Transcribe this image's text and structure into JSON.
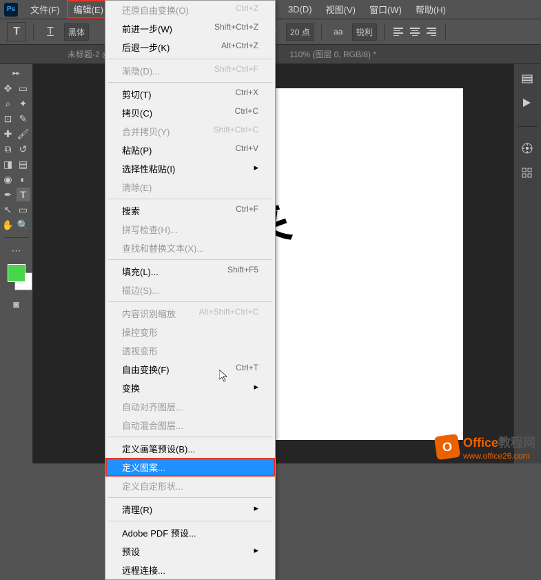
{
  "menubar": {
    "items": [
      "文件(F)",
      "编辑(E)",
      "",
      "",
      "3D(D)",
      "视图(V)",
      "窗口(W)",
      "帮助(H)"
    ],
    "active_index": 1
  },
  "optbar": {
    "tool": "T",
    "orient": "IT",
    "font_family": "黑体",
    "size_value": "20 点",
    "aa_label": "aa",
    "aa_value": "锐利"
  },
  "tabs": [
    "未标题-2 @",
    "110% (图层 0, RGB/8) *"
  ],
  "canvas": {
    "text": "徐来"
  },
  "dropdown": {
    "items": [
      {
        "label": "还原自由变换(O)",
        "shortcut": "Ctrl+Z",
        "disabled": true
      },
      {
        "label": "前进一步(W)",
        "shortcut": "Shift+Ctrl+Z"
      },
      {
        "label": "后退一步(K)",
        "shortcut": "Alt+Ctrl+Z"
      },
      {
        "sep": true
      },
      {
        "label": "渐隐(D)...",
        "shortcut": "Shift+Ctrl+F",
        "disabled": true
      },
      {
        "sep": true
      },
      {
        "label": "剪切(T)",
        "shortcut": "Ctrl+X"
      },
      {
        "label": "拷贝(C)",
        "shortcut": "Ctrl+C"
      },
      {
        "label": "合并拷贝(Y)",
        "shortcut": "Shift+Ctrl+C",
        "disabled": true
      },
      {
        "label": "粘贴(P)",
        "shortcut": "Ctrl+V"
      },
      {
        "label": "选择性粘贴(I)",
        "submenu": true
      },
      {
        "label": "清除(E)",
        "disabled": true
      },
      {
        "sep": true
      },
      {
        "label": "搜索",
        "shortcut": "Ctrl+F"
      },
      {
        "label": "拼写检查(H)...",
        "disabled": true
      },
      {
        "label": "查找和替换文本(X)...",
        "disabled": true
      },
      {
        "sep": true
      },
      {
        "label": "填充(L)...",
        "shortcut": "Shift+F5"
      },
      {
        "label": "描边(S)...",
        "disabled": true
      },
      {
        "sep": true
      },
      {
        "label": "内容识别缩放",
        "shortcut": "Alt+Shift+Ctrl+C",
        "disabled": true
      },
      {
        "label": "操控变形",
        "disabled": true
      },
      {
        "label": "透视变形",
        "disabled": true
      },
      {
        "label": "自由变换(F)",
        "shortcut": "Ctrl+T"
      },
      {
        "label": "变换",
        "submenu": true
      },
      {
        "label": "自动对齐图层...",
        "disabled": true
      },
      {
        "label": "自动混合图层...",
        "disabled": true
      },
      {
        "sep": true
      },
      {
        "label": "定义画笔预设(B)..."
      },
      {
        "label": "定义图案...",
        "highlighted": true
      },
      {
        "label": "定义自定形状...",
        "disabled": true
      },
      {
        "sep": true
      },
      {
        "label": "清理(R)",
        "submenu": true
      },
      {
        "sep": true
      },
      {
        "label": "Adobe PDF 预设..."
      },
      {
        "label": "预设",
        "submenu": true
      },
      {
        "label": "远程连接..."
      }
    ]
  },
  "watermark": {
    "title_a": "Office",
    "title_b": "教程网",
    "url": "www.office26.com"
  }
}
